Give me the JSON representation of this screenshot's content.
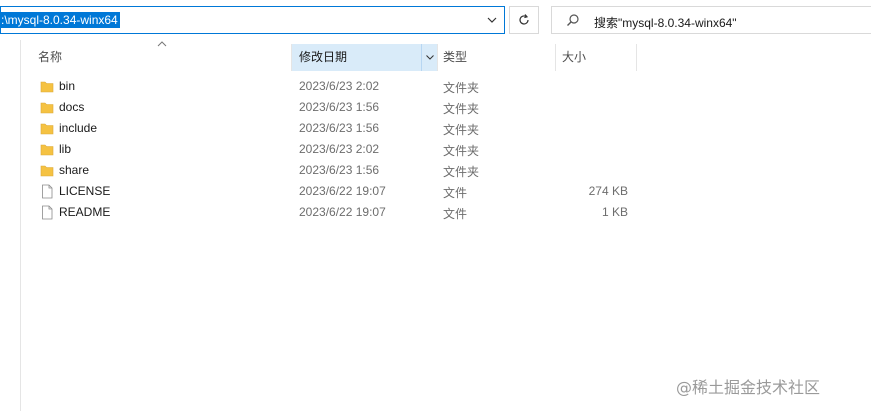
{
  "address_bar": {
    "path": ":\\mysql-8.0.34-winx64"
  },
  "search": {
    "placeholder": "搜索\"mysql-8.0.34-winx64\""
  },
  "columns": {
    "name": "名称",
    "date": "修改日期",
    "type": "类型",
    "size": "大小"
  },
  "files": [
    {
      "name": "bin",
      "date": "2023/6/23 2:02",
      "type": "文件夹",
      "size": "",
      "icon": "folder-icon"
    },
    {
      "name": "docs",
      "date": "2023/6/23 1:56",
      "type": "文件夹",
      "size": "",
      "icon": "folder-icon"
    },
    {
      "name": "include",
      "date": "2023/6/23 1:56",
      "type": "文件夹",
      "size": "",
      "icon": "folder-icon"
    },
    {
      "name": "lib",
      "date": "2023/6/23 2:02",
      "type": "文件夹",
      "size": "",
      "icon": "folder-icon"
    },
    {
      "name": "share",
      "date": "2023/6/23 1:56",
      "type": "文件夹",
      "size": "",
      "icon": "folder-icon"
    },
    {
      "name": "LICENSE",
      "date": "2023/6/22 19:07",
      "type": "文件",
      "size": "274 KB",
      "icon": "file-icon"
    },
    {
      "name": "README",
      "date": "2023/6/22 19:07",
      "type": "文件",
      "size": "1 KB",
      "icon": "file-icon"
    }
  ],
  "watermark": {
    "text": "@稀土掘金技术社区"
  },
  "colors": {
    "accent": "#0078d7",
    "sorted_header": "#d9ebf9",
    "folder": "#f5c242"
  }
}
